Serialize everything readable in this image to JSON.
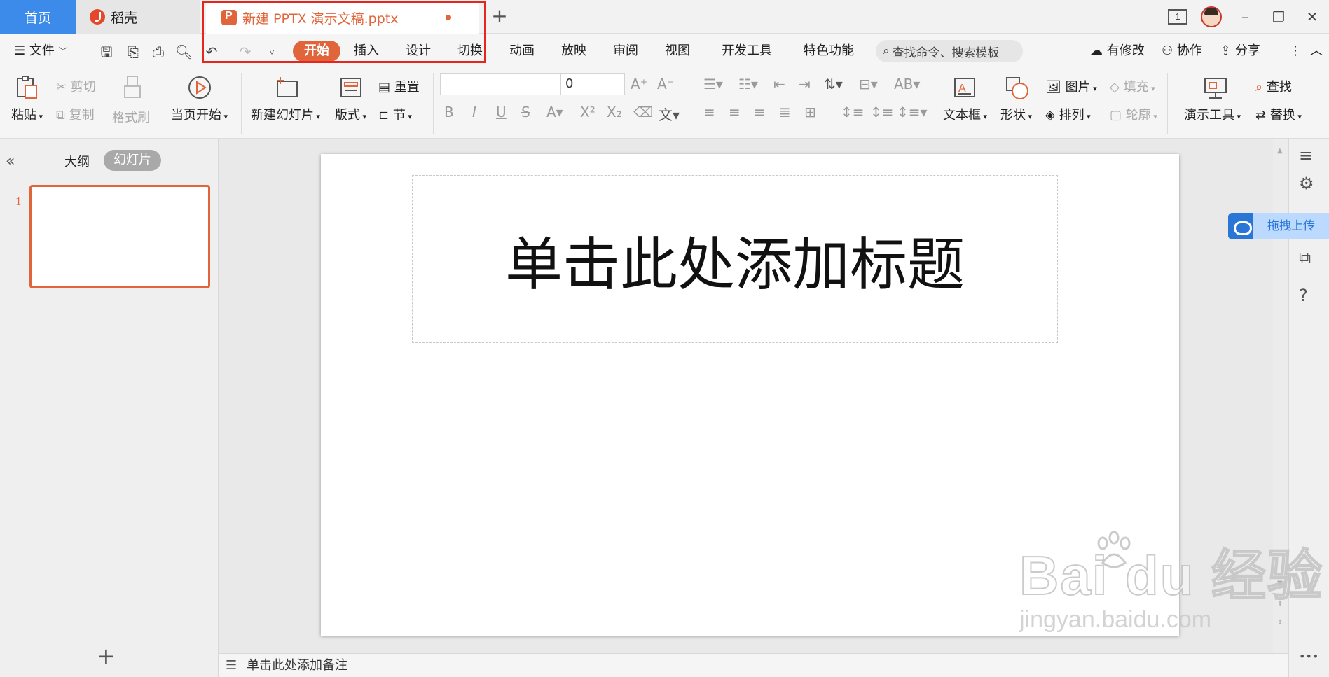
{
  "tabbar": {
    "home": "首页",
    "daoke": "稻壳",
    "doc_title": "新建 PPTX 演示文稿.pptx",
    "page_indicator": "1"
  },
  "menu": {
    "file": "文件",
    "tabs": [
      "开始",
      "插入",
      "设计",
      "切换",
      "动画",
      "放映",
      "审阅",
      "视图",
      "开发工具",
      "特色功能"
    ],
    "search_placeholder": "查找命令、搜索模板",
    "modified": "有修改",
    "collaborate": "协作",
    "share": "分享"
  },
  "ribbon": {
    "paste": "粘贴",
    "cut": "剪切",
    "copy": "复制",
    "format_painter": "格式刷",
    "from_current": "当页开始",
    "new_slide": "新建幻灯片",
    "layout": "版式",
    "reset": "重置",
    "section": "节",
    "font_size": "0",
    "textbox": "文本框",
    "shape": "形状",
    "picture": "图片",
    "fill": "填充",
    "arrange": "排列",
    "outline": "轮廓",
    "presentation_tools": "演示工具",
    "find": "查找",
    "replace": "替换"
  },
  "leftpanel": {
    "outline_tab": "大纲",
    "slides_tab": "幻灯片",
    "slide_number": "1"
  },
  "slide": {
    "title_placeholder": "单击此处添加标题"
  },
  "notes": {
    "placeholder": "单击此处添加备注"
  },
  "sidebar": {
    "upload": "拖拽上传"
  },
  "watermark": {
    "brand": "Bai du 经验",
    "url": "jingyan.baidu.com"
  },
  "colors": {
    "accent": "#e0653a",
    "home_tab": "#3c8bea",
    "highlight": "#e8251d"
  }
}
